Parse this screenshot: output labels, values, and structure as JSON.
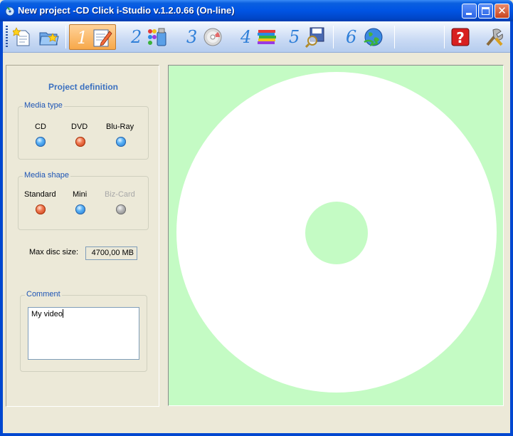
{
  "window": {
    "title": "New project -CD Click i-Studio v.1.2.0.66 (On-line)",
    "close_glyph": "✕"
  },
  "toolbar": {
    "items": [
      {
        "icon": "new-project-icon"
      },
      {
        "icon": "open-project-icon"
      },
      {
        "step": "1",
        "icon": "project-definition-icon",
        "active": true
      },
      {
        "step": "2",
        "icon": "paint-design-icon"
      },
      {
        "step": "3",
        "icon": "disc-icon"
      },
      {
        "step": "4",
        "icon": "disc-stack-icon"
      },
      {
        "step": "5",
        "icon": "save-preview-icon"
      },
      {
        "step": "6",
        "icon": "globe-icon"
      },
      {
        "icon": "help-icon"
      },
      {
        "icon": "tools-icon"
      }
    ]
  },
  "panel": {
    "title": "Project definition",
    "media_type": {
      "title": "Media type",
      "options": [
        {
          "label": "CD",
          "state": "blue"
        },
        {
          "label": "DVD",
          "state": "red"
        },
        {
          "label": "Blu-Ray",
          "state": "blue"
        }
      ]
    },
    "media_shape": {
      "title": "Media shape",
      "options": [
        {
          "label": "Standard",
          "state": "red"
        },
        {
          "label": "Mini",
          "state": "blue"
        },
        {
          "label": "Biz-Card",
          "state": "gray",
          "disabled": true
        }
      ]
    },
    "max_disc_size": {
      "label": "Max disc size:",
      "value": "4700,00 MB"
    },
    "comment": {
      "title": "Comment",
      "value": "My video"
    }
  },
  "canvas": {
    "background": "#C4FBC4",
    "disc_color": "#FFFFFF"
  }
}
